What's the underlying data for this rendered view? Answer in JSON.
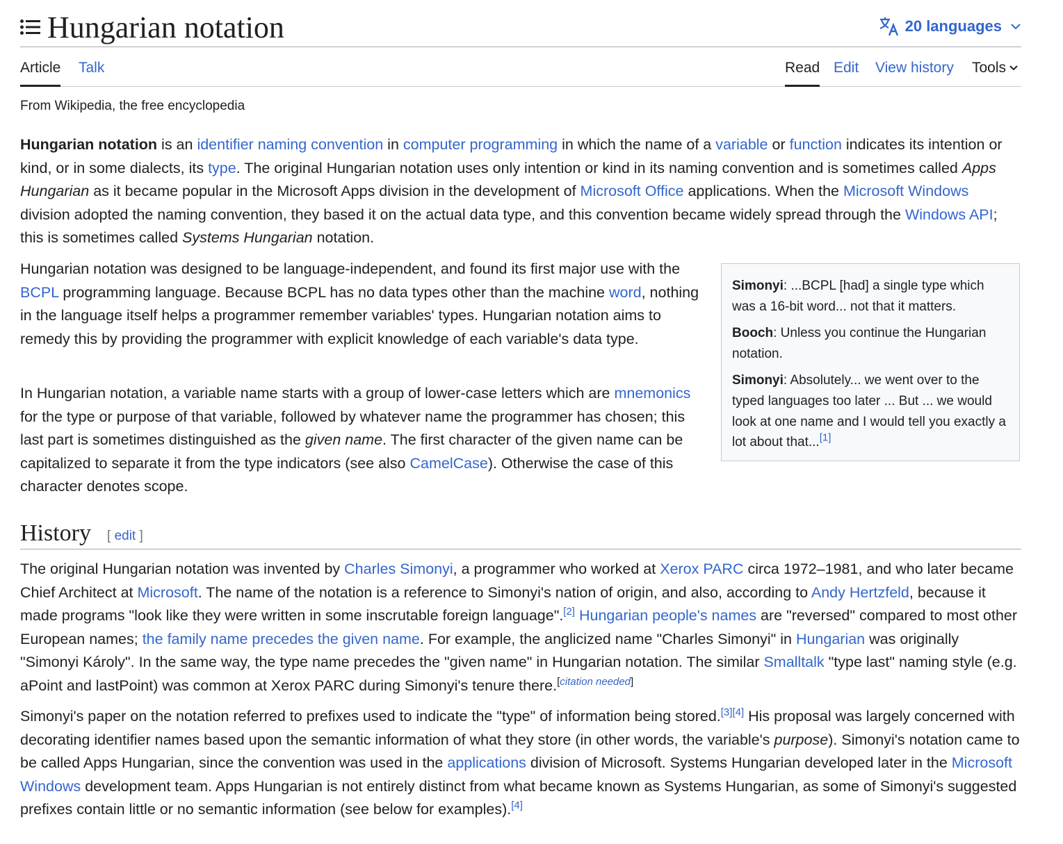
{
  "header": {
    "title": "Hungarian notation",
    "languages_label": "20 languages"
  },
  "tabs": {
    "article": "Article",
    "talk": "Talk",
    "read": "Read",
    "edit": "Edit",
    "view_history": "View history",
    "tools": "Tools"
  },
  "tagline": "From Wikipedia, the free encyclopedia",
  "intro": {
    "p1": {
      "bold": "Hungarian notation",
      "t1": " is an ",
      "l1": "identifier naming convention",
      "t2": " in ",
      "l2": "computer programming",
      "t3": " in which the name of a ",
      "l3": "variable",
      "t4": " or ",
      "l4": "function",
      "t5": " indicates its intention or kind, or in some dialects, its ",
      "l5": "type",
      "t6": ". The original Hungarian notation uses only intention or kind in its naming convention and is sometimes called ",
      "i1": "Apps Hungarian",
      "t7": " as it became popular in the Microsoft Apps division in the development of ",
      "l6": "Microsoft Office",
      "t8": " applications. When the ",
      "l7": "Microsoft Windows",
      "t9": " division adopted the naming convention, they based it on the actual data type, and this convention became widely spread through the ",
      "l8": "Windows API",
      "t10": "; this is sometimes called ",
      "i2": "Systems Hungarian",
      "t11": " notation."
    },
    "p2": {
      "t1": "Hungarian notation was designed to be language-independent, and found its first major use with the ",
      "l1": "BCPL",
      "t2": " programming language. Because BCPL has no data types other than the machine ",
      "l2": "word",
      "t3": ", nothing in the language itself helps a programmer remember variables' types. Hungarian notation aims to remedy this by providing the programmer with explicit knowledge of each variable's data type."
    },
    "p3": {
      "t1": "In Hungarian notation, a variable name starts with a group of lower-case letters which are ",
      "l1": "mnemonics",
      "t2": " for the type or purpose of that variable, followed by whatever name the programmer has chosen; this last part is sometimes distinguished as the ",
      "i1": "given name",
      "t3": ". The first character of the given name can be capitalized to separate it from the type indicators (see also ",
      "l2": "CamelCase",
      "t4": "). Otherwise the case of this character denotes scope."
    }
  },
  "quote": {
    "q1_speaker": "Simonyi",
    "q1_text": ": ...BCPL [had] a single type which was a 16-bit word... not that it matters.",
    "q2_speaker": "Booch",
    "q2_text": ": Unless you continue the Hungarian notation.",
    "q3_speaker": "Simonyi",
    "q3_text": ": Absolutely... we went over to the typed languages too later ... But ... we would look at one name and I would tell you exactly a lot about that...",
    "q3_ref": "[1]"
  },
  "history": {
    "heading": "History",
    "edit_open": "[ ",
    "edit_label": "edit",
    "edit_close": " ]",
    "p1": {
      "t1": "The original Hungarian notation was invented by ",
      "l1": "Charles Simonyi",
      "t2": ", a programmer who worked at ",
      "l2": "Xerox PARC",
      "t3": " circa 1972–1981, and who later became Chief Architect at ",
      "l3": "Microsoft",
      "t4": ". The name of the notation is a reference to Simonyi's nation of origin, and also, according to ",
      "l4": "Andy Hertzfeld",
      "t5": ", because it made programs \"look like they were written in some inscrutable foreign language\".",
      "r1": "[2]",
      "t6": " ",
      "l5": "Hungarian people's names",
      "t7": " are \"reversed\" compared to most other European names; ",
      "l6": "the family name precedes the given name",
      "t8": ". For example, the anglicized name \"Charles Simonyi\" in ",
      "l7": "Hungarian",
      "t9": " was originally \"Simonyi Károly\". In the same way, the type name precedes the \"given name\" in Hungarian notation. The similar ",
      "l8": "Smalltalk",
      "t10": " \"type last\" naming style (e.g. aPoint and lastPoint) was common at Xerox PARC during Simonyi's tenure there.",
      "cn_open": "[",
      "cn_text": "citation needed",
      "cn_close": "]"
    },
    "p2": {
      "t1": "Simonyi's paper on the notation referred to prefixes used to indicate the \"type\" of information being stored.",
      "r1": "[3]",
      "r2": "[4]",
      "t2": " His proposal was largely concerned with decorating identifier names based upon the semantic information of what they store (in other words, the variable's ",
      "i1": "purpose",
      "t3": "). Simonyi's notation came to be called Apps Hungarian, since the convention was used in the ",
      "l1": "applications",
      "t4": " division of Microsoft. Systems Hungarian developed later in the ",
      "l2": "Microsoft Windows",
      "t5": " development team. Apps Hungarian is not entirely distinct from what became known as Systems Hungarian, as some of Simonyi's suggested prefixes contain little or no semantic information (see below for examples).",
      "r3": "[4]"
    }
  },
  "icons": {
    "toc": "toc-list-icon",
    "language": "language-icon",
    "chevron": "chevron-down-icon"
  },
  "colors": {
    "link": "#3366cc",
    "text": "#202122",
    "border": "#a2a9b1",
    "quote_bg": "#f8f9fa"
  }
}
